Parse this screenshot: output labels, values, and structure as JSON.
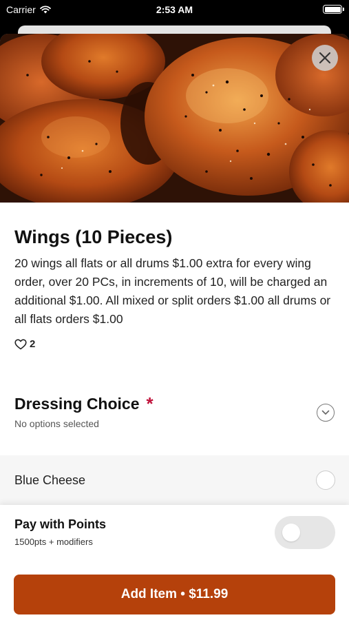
{
  "status_bar": {
    "carrier": "Carrier",
    "time": "2:53 AM",
    "icons": [
      "wifi-icon",
      "battery-icon"
    ]
  },
  "item": {
    "title": "Wings (10 Pieces)",
    "description": "20 wings all flats or all drums $1.00 extra for every wing order, over 20 PCs, in increments of 10, will be charged an additional $1.00. All mixed or split orders $1.00 all drums or all flats orders $1.00",
    "likes_count": "2",
    "hero_image": "chicken-wings-photo"
  },
  "dressing_section": {
    "title": "Dressing Choice",
    "required_mark": "*",
    "subtitle": "No options selected",
    "options": [
      {
        "label": "Blue Cheese",
        "selected": false
      }
    ]
  },
  "pay_with_points": {
    "title": "Pay with Points",
    "subtitle": "1500pts + modifiers",
    "enabled": false
  },
  "cta": {
    "label": "Add Item • $11.99"
  },
  "colors": {
    "accent": "#b5410b",
    "required": "#c0143c",
    "toggle_off": "#e6e6e6"
  }
}
